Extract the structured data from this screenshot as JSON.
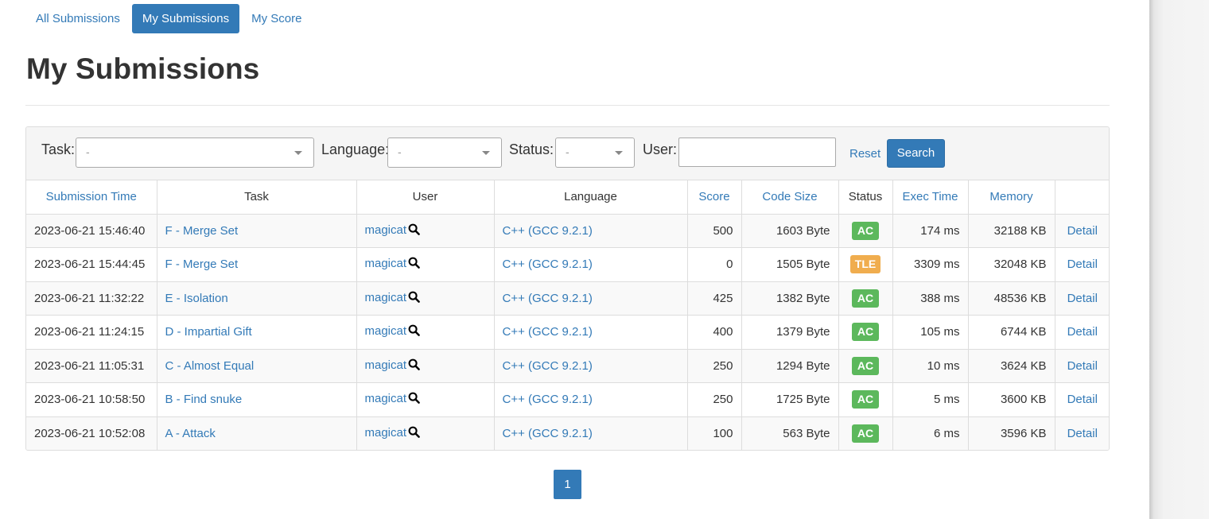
{
  "nav": {
    "tabs": [
      {
        "label": "All Submissions"
      },
      {
        "label": "My Submissions"
      },
      {
        "label": "My Score"
      }
    ]
  },
  "page_title": "My Submissions",
  "filters": {
    "task_label": "Task:",
    "task_value": "-",
    "language_label": "Language:",
    "language_value": "-",
    "status_label": "Status:",
    "status_value": "-",
    "user_label": "User:",
    "user_value": "",
    "reset_label": "Reset",
    "search_label": "Search"
  },
  "table": {
    "headers": [
      "Submission Time",
      "Task",
      "User",
      "Language",
      "Score",
      "Code Size",
      "Status",
      "Exec Time",
      "Memory",
      ""
    ],
    "rows": [
      {
        "time": "2023-06-21 15:46:40",
        "task": "F - Merge Set",
        "user": "magicat",
        "language": "C++ (GCC 9.2.1)",
        "score": "500",
        "code_size": "1603 Byte",
        "status": "AC",
        "exec_time": "174 ms",
        "memory": "32188 KB",
        "detail": "Detail"
      },
      {
        "time": "2023-06-21 15:44:45",
        "task": "F - Merge Set",
        "user": "magicat",
        "language": "C++ (GCC 9.2.1)",
        "score": "0",
        "code_size": "1505 Byte",
        "status": "TLE",
        "exec_time": "3309 ms",
        "memory": "32048 KB",
        "detail": "Detail"
      },
      {
        "time": "2023-06-21 11:32:22",
        "task": "E - Isolation",
        "user": "magicat",
        "language": "C++ (GCC 9.2.1)",
        "score": "425",
        "code_size": "1382 Byte",
        "status": "AC",
        "exec_time": "388 ms",
        "memory": "48536 KB",
        "detail": "Detail"
      },
      {
        "time": "2023-06-21 11:24:15",
        "task": "D - Impartial Gift",
        "user": "magicat",
        "language": "C++ (GCC 9.2.1)",
        "score": "400",
        "code_size": "1379 Byte",
        "status": "AC",
        "exec_time": "105 ms",
        "memory": "6744 KB",
        "detail": "Detail"
      },
      {
        "time": "2023-06-21 11:05:31",
        "task": "C - Almost Equal",
        "user": "magicat",
        "language": "C++ (GCC 9.2.1)",
        "score": "250",
        "code_size": "1294 Byte",
        "status": "AC",
        "exec_time": "10 ms",
        "memory": "3624 KB",
        "detail": "Detail"
      },
      {
        "time": "2023-06-21 10:58:50",
        "task": "B - Find snuke",
        "user": "magicat",
        "language": "C++ (GCC 9.2.1)",
        "score": "250",
        "code_size": "1725 Byte",
        "status": "AC",
        "exec_time": "5 ms",
        "memory": "3600 KB",
        "detail": "Detail"
      },
      {
        "time": "2023-06-21 10:52:08",
        "task": "A - Attack",
        "user": "magicat",
        "language": "C++ (GCC 9.2.1)",
        "score": "100",
        "code_size": "563 Byte",
        "status": "AC",
        "exec_time": "6 ms",
        "memory": "3596 KB",
        "detail": "Detail"
      }
    ]
  },
  "status_colors": {
    "AC": "#5cb85c",
    "TLE": "#f0ad4e"
  },
  "pagination": {
    "current": "1"
  }
}
